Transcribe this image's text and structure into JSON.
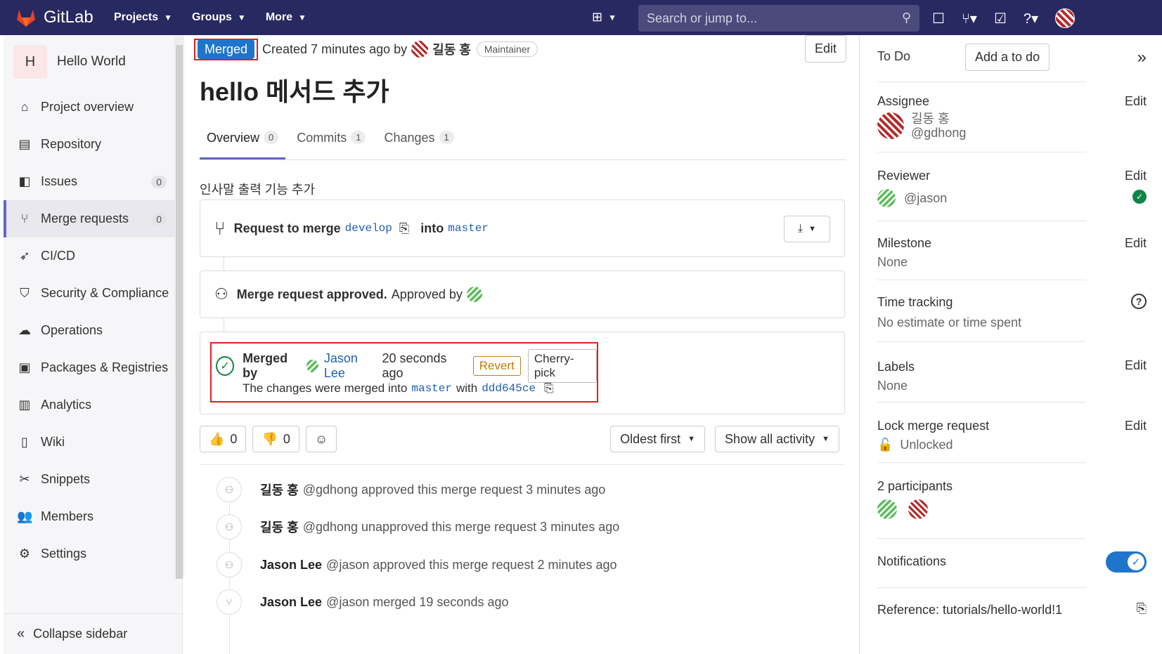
{
  "topbar": {
    "brand": "GitLab",
    "nav": [
      "Projects",
      "Groups",
      "More"
    ],
    "search_placeholder": "Search or jump to..."
  },
  "sidebar": {
    "project_initial": "H",
    "project_name": "Hello World",
    "items": [
      {
        "label": "Project overview",
        "icon": "home-icon"
      },
      {
        "label": "Repository",
        "icon": "document-icon"
      },
      {
        "label": "Issues",
        "icon": "issues-icon",
        "count": "0"
      },
      {
        "label": "Merge requests",
        "icon": "merge-request-icon",
        "count": "0",
        "active": true
      },
      {
        "label": "CI/CD",
        "icon": "rocket-icon"
      },
      {
        "label": "Security & Compliance",
        "icon": "shield-icon"
      },
      {
        "label": "Operations",
        "icon": "cloud-icon"
      },
      {
        "label": "Packages & Registries",
        "icon": "package-icon"
      },
      {
        "label": "Analytics",
        "icon": "analytics-icon"
      },
      {
        "label": "Wiki",
        "icon": "book-icon"
      },
      {
        "label": "Snippets",
        "icon": "scissors-icon"
      },
      {
        "label": "Members",
        "icon": "users-icon"
      },
      {
        "label": "Settings",
        "icon": "gear-icon"
      }
    ],
    "collapse_label": "Collapse sidebar"
  },
  "header": {
    "status": "Merged",
    "created": "Created 7 minutes ago by",
    "author": "길동 홍",
    "role": "Maintainer",
    "edit": "Edit"
  },
  "mr": {
    "title": "hello 메서드 추가",
    "tabs": [
      {
        "label": "Overview",
        "count": "0"
      },
      {
        "label": "Commits",
        "count": "1"
      },
      {
        "label": "Changes",
        "count": "1"
      }
    ],
    "description": "인사말 출력 기능 추가",
    "request_to_merge": "Request to merge",
    "source_branch": "develop",
    "into": "into",
    "target_branch": "master",
    "approved_bold": "Merge request approved.",
    "approved_by": "Approved by",
    "merged_by": "Merged by",
    "merged_user": "Jason Lee",
    "merged_time": "20 seconds ago",
    "revert": "Revert",
    "cherry_pick": "Cherry-pick",
    "changes_merged_into": "The changes were merged into",
    "with": "with",
    "commit_sha": "ddd645ce"
  },
  "reactions": {
    "thumbs_up": "0",
    "thumbs_down": "0",
    "sort": "Oldest first",
    "filter": "Show all activity"
  },
  "activity": [
    {
      "name": "길동 홍",
      "text": "@gdhong approved this merge request 3 minutes ago"
    },
    {
      "name": "길동 홍",
      "text": "@gdhong unapproved this merge request 3 minutes ago"
    },
    {
      "name": "Jason Lee",
      "text": "@jason approved this merge request 2 minutes ago"
    },
    {
      "name": "Jason Lee",
      "text": "@jason merged 19 seconds ago"
    }
  ],
  "right_sidebar": {
    "todo": "To Do",
    "add_todo": "Add a to do",
    "assignee_title": "Assignee",
    "assignee_name": "길동 홍",
    "assignee_user": "@gdhong",
    "reviewer_title": "Reviewer",
    "reviewer_user": "@jason",
    "milestone_title": "Milestone",
    "milestone_value": "None",
    "time_title": "Time tracking",
    "time_value": "No estimate or time spent",
    "labels_title": "Labels",
    "labels_value": "None",
    "lock_title": "Lock merge request",
    "lock_value": "Unlocked",
    "participants": "2 participants",
    "notifications": "Notifications",
    "reference": "Reference: tutorials/hello-world!1",
    "edit": "Edit"
  }
}
